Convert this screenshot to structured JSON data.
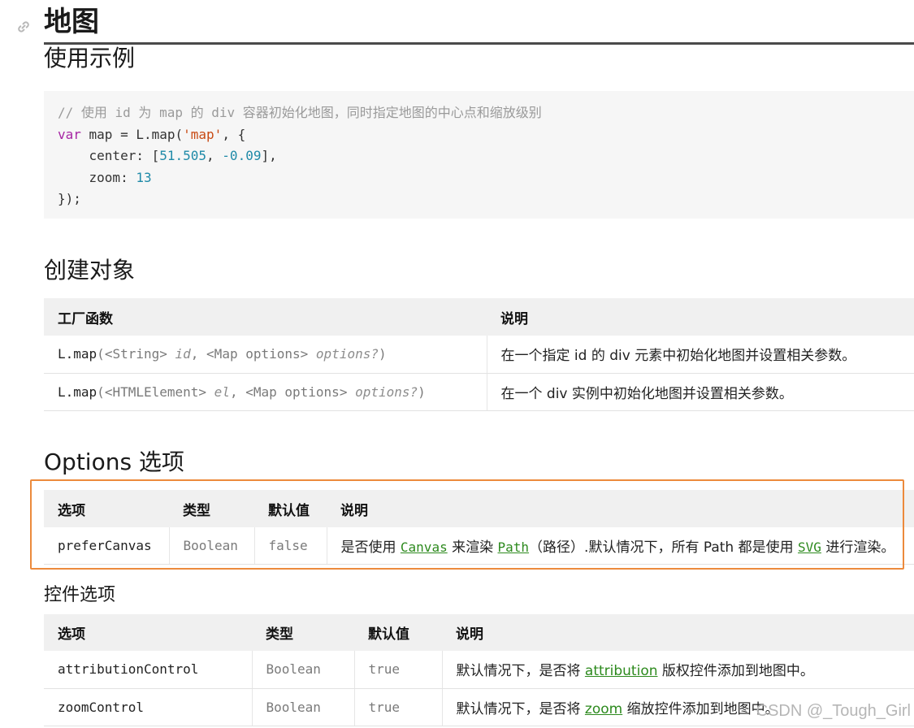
{
  "page": {
    "title": "地图",
    "usage_heading": "使用示例",
    "create_heading": "创建对象",
    "options_heading": "Options 选项",
    "controls_heading": "控件选项"
  },
  "code": {
    "comment": "// 使用 id 为 map 的 div 容器初始化地图，同时指定地图的中心点和缩放级别",
    "kw_var": "var",
    "map_assign": " map = L.map(",
    "map_str": "'map'",
    "map_open": ", {",
    "center_label": "    center: [",
    "center_lat": "51.505",
    "center_sep": ", ",
    "center_lng": "-0.09",
    "center_close": "],",
    "zoom_label": "    zoom: ",
    "zoom_value": "13",
    "closing": "});"
  },
  "create_table": {
    "headers": [
      "工厂函数",
      "说明"
    ],
    "rows": [
      {
        "fn": "L.map",
        "p1": "(",
        "t1": "<String>",
        "a1": " id",
        "p2": ", ",
        "t2": "<Map options>",
        "a2": " options?",
        "p3": ")",
        "desc": "在一个指定 id 的 div 元素中初始化地图并设置相关参数。"
      },
      {
        "fn": "L.map",
        "p1": "(",
        "t1": "<HTMLElement>",
        "a1": " el",
        "p2": ", ",
        "t2": "<Map options>",
        "a2": " options?",
        "p3": ")",
        "desc": "在一个 div 实例中初始化地图并设置相关参数。"
      }
    ]
  },
  "options_table": {
    "headers": [
      "选项",
      "类型",
      "默认值",
      "说明"
    ],
    "row": {
      "option": "preferCanvas",
      "type": "Boolean",
      "default": "false",
      "desc_1": "是否使用 ",
      "link_canvas": "Canvas",
      "desc_2": " 来渲染 ",
      "link_path": "Path",
      "desc_3": "（路径）.默认情况下，所有 Path 都是使用 ",
      "link_svg": "SVG",
      "desc_4": " 进行渲染。"
    }
  },
  "controls_table": {
    "headers": [
      "选项",
      "类型",
      "默认值",
      "说明"
    ],
    "rows": [
      {
        "option": "attributionControl",
        "type": "Boolean",
        "default": "true",
        "desc_1": "默认情况下，是否将 ",
        "link": "attribution",
        "desc_2": " 版权控件添加到地图中。"
      },
      {
        "option": "zoomControl",
        "type": "Boolean",
        "default": "true",
        "desc_1": "默认情况下，是否将 ",
        "link": "zoom",
        "desc_2": " 缩放控件添加到地图中。"
      }
    ]
  },
  "watermark": "CSDN @_Tough_Girl",
  "colors": {
    "link": "#2d8a1e",
    "highlight_border": "#ec8a3c",
    "code_bg": "#f6f6f6",
    "header_bg": "#f0f0f0"
  },
  "icons": [
    "link-icon"
  ]
}
